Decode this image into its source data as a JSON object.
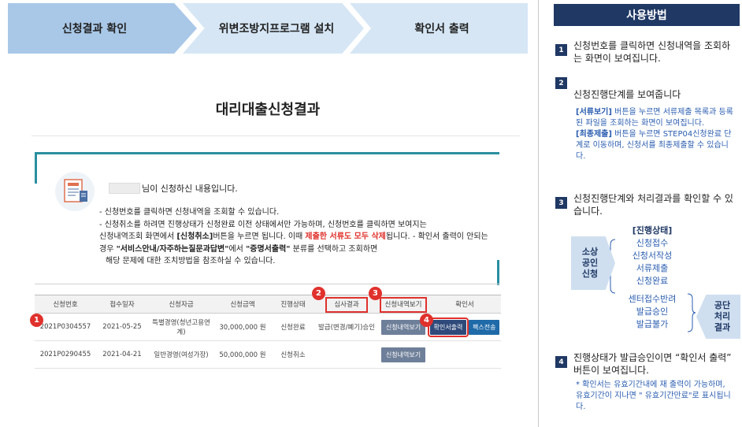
{
  "steps": [
    {
      "label": "신청결과 확인"
    },
    {
      "label": "위변조방지프로그램 설치"
    },
    {
      "label": "확인서 출력"
    }
  ],
  "page_title": "대리대출신청결과",
  "name_suffix": "님이 신청하신 내용입니다.",
  "notice": {
    "line1": "- 신청번호를 클릭하면 신청내역을 조회할 수 있습니다.",
    "line2": "- 신청취소를 하려면 진행상태가 신청완료 이전 상태에서만 가능하며, 신청번호를 클릭하면 보여지는",
    "line3_a": "신청내역조회 화면에서 ",
    "line3_b": "[신청취소]",
    "line3_c": "버튼을 누르면 됩니다. 이때 ",
    "line3_red": "제출한 서류도 모두 삭제",
    "line3_d": "됩니다. - 확인서 출력이 안되는",
    "line4_a": "경우 ",
    "line4_b": "\"서비스안내/자주하는질문과답변\"",
    "line4_c": "에서 ",
    "line4_d": "\"증명서출력\"",
    "line4_e": " 분류를 선택하고 조회하면",
    "line5": "해당 문제에 대한 조치방법을 참조하실 수 있습니다."
  },
  "table": {
    "headers": [
      "신청번호",
      "접수일자",
      "신청자금",
      "신청금액",
      "진행상태",
      "심사결과",
      "신청내역보기",
      "확인서"
    ],
    "rows": [
      {
        "no": "2021P0304557",
        "date": "2021-05-25",
        "fund": "특별경영(청년고용연계)",
        "amount": "30,000,000 원",
        "status": "신청완료",
        "result": "발급(변경/폐기)승인",
        "view": "신청내역보기",
        "print": "확인서출력",
        "fax": "팩스전송"
      },
      {
        "no": "2021P0290455",
        "date": "2021-04-21",
        "fund": "일반경영(여성가장)",
        "amount": "50,000,000 원",
        "status": "신청취소",
        "result": "",
        "view": "신청내역보기"
      }
    ]
  },
  "markers": [
    "1",
    "2",
    "3",
    "4"
  ],
  "panel": {
    "title": "사용방법",
    "s1_text": "신청번호를 클릭하면 신청내역을 조회하는 화면이 보여집니다.",
    "s2_text": "신청진행단계를 보여줍니다",
    "s2_b1": "[서류보기]",
    "s2_t1": " 버튼을 누르면 서류제출 목록과 등록된 파일을 조회하는 화면이 보여집니다.",
    "s2_b2": "[최종제출]",
    "s2_t2": " 버튼을 누르면 STEP04신청완료 단계로 이동하며, 신청서를 최종제출할 수 있습니다.",
    "s3_text": "신청진행단계와 처리결과를 확인할 수 있습니다.",
    "state_title": "[진행상태]",
    "left_chev": [
      "소상",
      "공인",
      "신청"
    ],
    "group1": [
      "신청접수",
      "신청서작성",
      "서류제출",
      "신청완료"
    ],
    "group2": [
      "센터접수반려",
      "발급승인",
      "발급불가"
    ],
    "right_chev": [
      "공단",
      "처리",
      "결과"
    ],
    "s4_text": "진행상태가 발급승인이면 “확인서 출력” 버튼이 보여집니다.",
    "s4_note": "* 확인서는 유효기간내에 재 출력이 가능하며, 유효기간이 지나면 \" 유효기간만료\"로 표시됩니다."
  },
  "colors": {
    "navy": "#1f3864",
    "accent_red": "#e0312c",
    "teal": "#2a8fa0",
    "blue_text": "#2a5db0"
  }
}
